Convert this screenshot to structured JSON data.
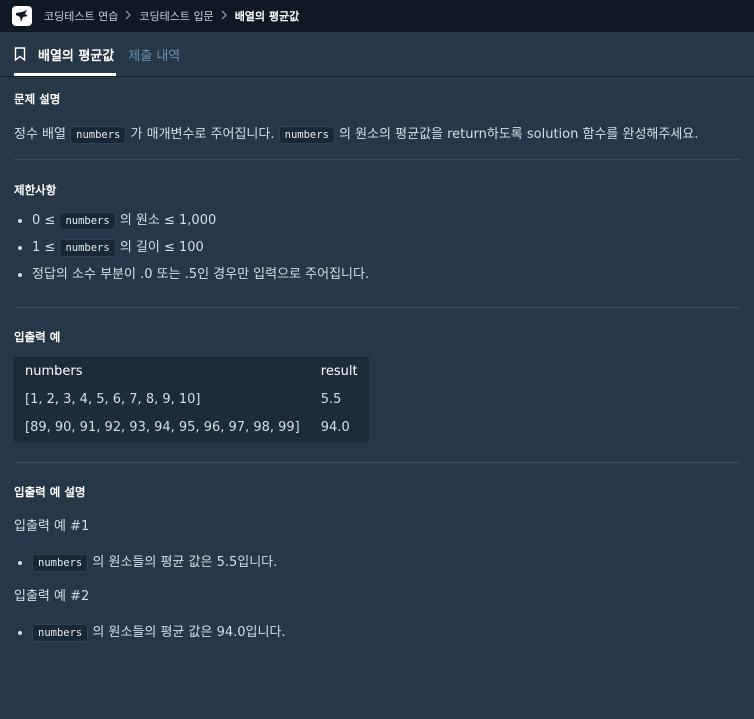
{
  "breadcrumb": {
    "items": [
      "코딩테스트 연습",
      "코딩테스트 입문"
    ],
    "current": "배열의 평균값"
  },
  "tabs": {
    "problem": "배열의 평균값",
    "submissions": "제출 내역"
  },
  "description": {
    "heading": "문제 설명",
    "pre": "정수 배열",
    "code1": "numbers",
    "mid": "가 매개변수로 주어집니다.",
    "code2": "numbers",
    "post": "의 원소의 평균값을 return하도록 solution 함수를 완성해주세요."
  },
  "constraints": {
    "heading": "제한사항",
    "items": [
      {
        "pre": "0 ≤",
        "code": "numbers",
        "post": "의 원소 ≤ 1,000"
      },
      {
        "pre": "1 ≤",
        "code": "numbers",
        "post": "의 길이 ≤ 100"
      },
      {
        "text": "정답의 소수 부분이 .0 또는 .5인 경우만 입력으로 주어집니다."
      }
    ]
  },
  "io_example": {
    "heading": "입출력 예",
    "headers": [
      "numbers",
      "result"
    ],
    "rows": [
      [
        "[1, 2, 3, 4, 5, 6, 7, 8, 9, 10]",
        "5.5"
      ],
      [
        "[89, 90, 91, 92, 93, 94, 95, 96, 97, 98, 99]",
        "94.0"
      ]
    ]
  },
  "io_explanation": {
    "heading": "입출력 예 설명",
    "examples": [
      {
        "title": "입출력 예 #1",
        "code": "numbers",
        "text": "의 원소들의 평균 값은 5.5입니다."
      },
      {
        "title": "입출력 예 #2",
        "code": "numbers",
        "text": "의 원소들의 평균 값은 94.0입니다."
      }
    ]
  },
  "colors": {
    "background": "#263747",
    "topbar": "#0f1923",
    "muted_tab": "#6e8ea9"
  },
  "icons": [
    "logo-icon",
    "chevron-right-icon",
    "bookmark-icon"
  ]
}
